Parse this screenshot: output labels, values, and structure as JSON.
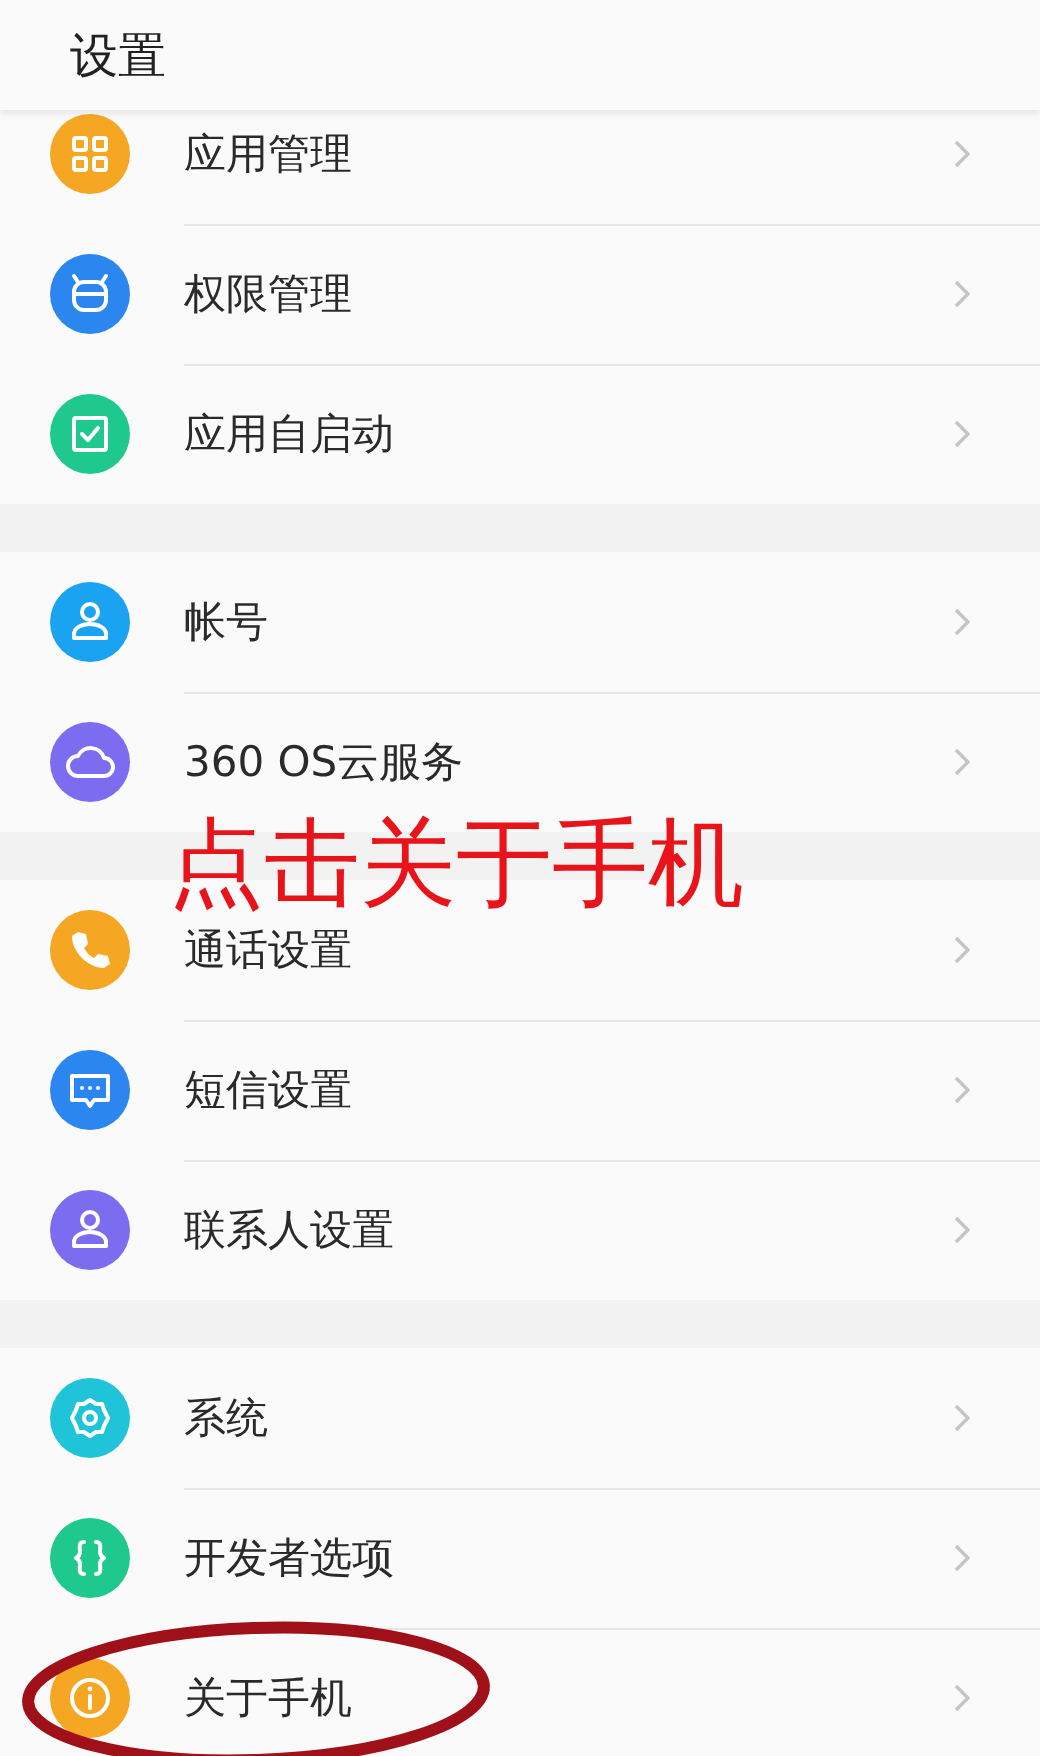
{
  "header": {
    "title": "设置"
  },
  "groups": [
    {
      "items": [
        {
          "label": "应用管理",
          "color": "#f5a623",
          "circled": false
        },
        {
          "label": "权限管理",
          "color": "#2b86ef",
          "circled": false
        },
        {
          "label": "应用自启动",
          "color": "#1fc98e",
          "circled": false
        }
      ]
    },
    {
      "items": [
        {
          "label": "帐号",
          "color": "#1aa3f0",
          "circled": false
        },
        {
          "label": "360 OS云服务",
          "color": "#7b6cf0",
          "circled": false
        }
      ]
    },
    {
      "items": [
        {
          "label": "通话设置",
          "color": "#f5a623",
          "circled": false
        },
        {
          "label": "短信设置",
          "color": "#2b86ef",
          "circled": false
        },
        {
          "label": "联系人设置",
          "color": "#7b6cf0",
          "circled": false
        }
      ]
    },
    {
      "items": [
        {
          "label": "系统",
          "color": "#20c4d8",
          "circled": false
        },
        {
          "label": "开发者选项",
          "color": "#1fc98e",
          "circled": false
        },
        {
          "label": "关于手机",
          "color": "#f5a623",
          "circled": true
        }
      ]
    }
  ],
  "annotation": {
    "text": "点击关于手机"
  }
}
